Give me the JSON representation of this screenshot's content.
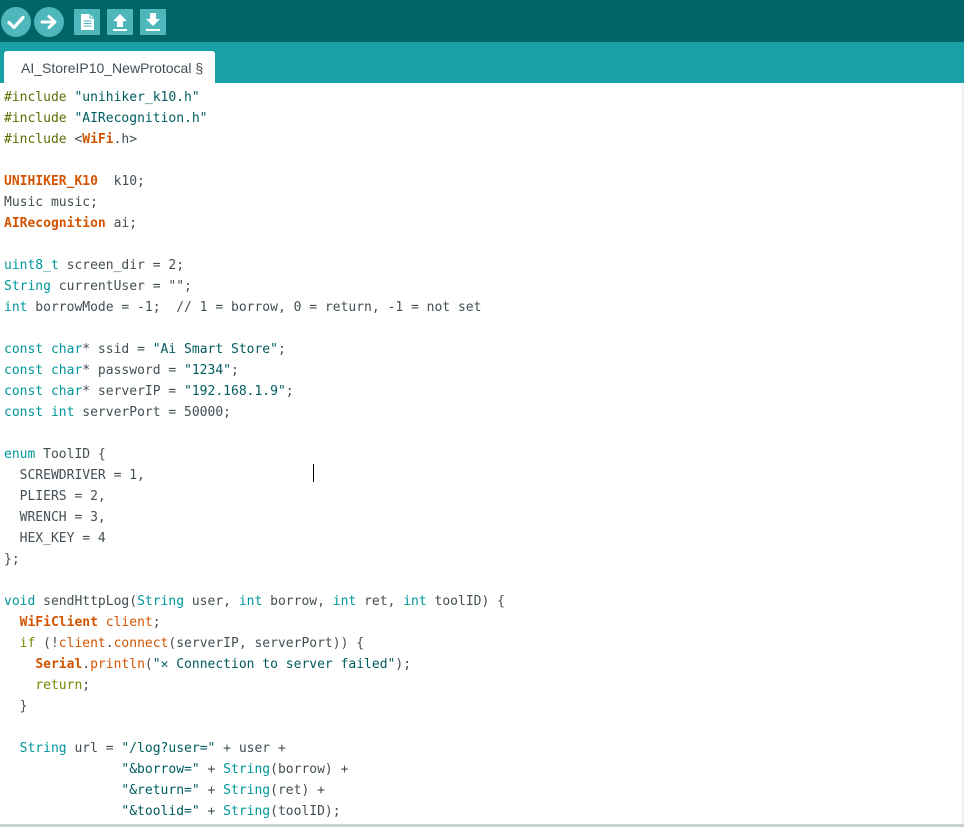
{
  "app": {
    "colors": {
      "toolbar": "#006468",
      "tabbar": "#17a1a5",
      "button": "#4db7bb",
      "editor_bg": "#ffffff"
    }
  },
  "toolbar": {
    "buttons": [
      {
        "name": "verify",
        "icon": "checkmark-icon"
      },
      {
        "name": "upload",
        "icon": "arrow-right-icon"
      },
      {
        "name": "new",
        "icon": "document-icon"
      },
      {
        "name": "open",
        "icon": "arrow-up-icon"
      },
      {
        "name": "save",
        "icon": "arrow-down-icon"
      }
    ]
  },
  "tabs": [
    {
      "label": "AI_StoreIP10_NewProtocal §"
    }
  ],
  "editor": {
    "lines": [
      [
        [
          "dir",
          "#include"
        ],
        [
          "id",
          " "
        ],
        [
          "str",
          "\"unihiker_k10.h\""
        ]
      ],
      [
        [
          "dir",
          "#include"
        ],
        [
          "id",
          " "
        ],
        [
          "str",
          "\"AIRecognition.h\""
        ]
      ],
      [
        [
          "dir",
          "#include"
        ],
        [
          "id",
          " <"
        ],
        [
          "cls",
          "WiFi"
        ],
        [
          "id",
          ".h>"
        ]
      ],
      [],
      [
        [
          "cls",
          "UNIHIKER_K10"
        ],
        [
          "id",
          "  k10;"
        ]
      ],
      [
        [
          "id",
          "Music music;"
        ]
      ],
      [
        [
          "cls",
          "AIRecognition"
        ],
        [
          "id",
          " ai;"
        ]
      ],
      [],
      [
        [
          "type",
          "uint8_t"
        ],
        [
          "id",
          " screen_dir = 2;"
        ]
      ],
      [
        [
          "type",
          "String"
        ],
        [
          "id",
          " currentUser = \"\";"
        ]
      ],
      [
        [
          "type",
          "int"
        ],
        [
          "id",
          " borrowMode = -1;  "
        ],
        [
          "cmt",
          "// 1 = borrow, 0 = return, -1 = not set"
        ]
      ],
      [],
      [
        [
          "type",
          "const"
        ],
        [
          "id",
          " "
        ],
        [
          "type",
          "char"
        ],
        [
          "id",
          "* ssid = "
        ],
        [
          "str",
          "\"Ai Smart Store\""
        ],
        [
          "id",
          ";"
        ]
      ],
      [
        [
          "type",
          "const"
        ],
        [
          "id",
          " "
        ],
        [
          "type",
          "char"
        ],
        [
          "id",
          "* password = "
        ],
        [
          "str",
          "\"1234\""
        ],
        [
          "id",
          ";"
        ]
      ],
      [
        [
          "type",
          "const"
        ],
        [
          "id",
          " "
        ],
        [
          "type",
          "char"
        ],
        [
          "id",
          "* serverIP = "
        ],
        [
          "str",
          "\"192.168.1.9\""
        ],
        [
          "id",
          ";"
        ]
      ],
      [
        [
          "type",
          "const"
        ],
        [
          "id",
          " "
        ],
        [
          "type",
          "int"
        ],
        [
          "id",
          " serverPort = 50000;"
        ]
      ],
      [],
      [
        [
          "type",
          "enum"
        ],
        [
          "id",
          " ToolID {"
        ]
      ],
      [
        [
          "id",
          "  SCREWDRIVER = 1,"
        ]
      ],
      [
        [
          "id",
          "  PLIERS = 2,"
        ]
      ],
      [
        [
          "id",
          "  WRENCH = 3,"
        ]
      ],
      [
        [
          "id",
          "  HEX_KEY = 4"
        ]
      ],
      [
        [
          "id",
          "};"
        ]
      ],
      [],
      [
        [
          "type",
          "void"
        ],
        [
          "id",
          " sendHttpLog("
        ],
        [
          "type",
          "String"
        ],
        [
          "id",
          " user, "
        ],
        [
          "type",
          "int"
        ],
        [
          "id",
          " borrow, "
        ],
        [
          "type",
          "int"
        ],
        [
          "id",
          " ret, "
        ],
        [
          "type",
          "int"
        ],
        [
          "id",
          " toolID) {"
        ]
      ],
      [
        [
          "id",
          "  "
        ],
        [
          "cls",
          "WiFiClient"
        ],
        [
          "id",
          " "
        ],
        [
          "fn",
          "client"
        ],
        [
          "id",
          ";"
        ]
      ],
      [
        [
          "id",
          "  "
        ],
        [
          "kw",
          "if"
        ],
        [
          "id",
          " (!"
        ],
        [
          "fn",
          "client"
        ],
        [
          "id",
          "."
        ],
        [
          "fn",
          "connect"
        ],
        [
          "id",
          "(serverIP, serverPort)) {"
        ]
      ],
      [
        [
          "id",
          "    "
        ],
        [
          "cls",
          "Serial"
        ],
        [
          "id",
          "."
        ],
        [
          "fn",
          "println"
        ],
        [
          "id",
          "("
        ],
        [
          "str",
          "\""
        ],
        [
          "x",
          "✕"
        ],
        [
          "str",
          " Connection to server failed\""
        ],
        [
          "id",
          ");"
        ]
      ],
      [
        [
          "id",
          "    "
        ],
        [
          "kw",
          "return"
        ],
        [
          "id",
          ";"
        ]
      ],
      [
        [
          "id",
          "  }"
        ]
      ],
      [],
      [
        [
          "id",
          "  "
        ],
        [
          "type",
          "String"
        ],
        [
          "id",
          " url = "
        ],
        [
          "str",
          "\"/log?user=\""
        ],
        [
          "id",
          " + user +"
        ]
      ],
      [
        [
          "id",
          "               "
        ],
        [
          "str",
          "\"&borrow=\""
        ],
        [
          "id",
          " + "
        ],
        [
          "type",
          "String"
        ],
        [
          "id",
          "(borrow) +"
        ]
      ],
      [
        [
          "id",
          "               "
        ],
        [
          "str",
          "\"&return=\""
        ],
        [
          "id",
          " + "
        ],
        [
          "type",
          "String"
        ],
        [
          "id",
          "(ret) +"
        ]
      ],
      [
        [
          "id",
          "               "
        ],
        [
          "str",
          "\"&toolid=\""
        ],
        [
          "id",
          " + "
        ],
        [
          "type",
          "String"
        ],
        [
          "id",
          "(toolID);"
        ]
      ]
    ]
  }
}
